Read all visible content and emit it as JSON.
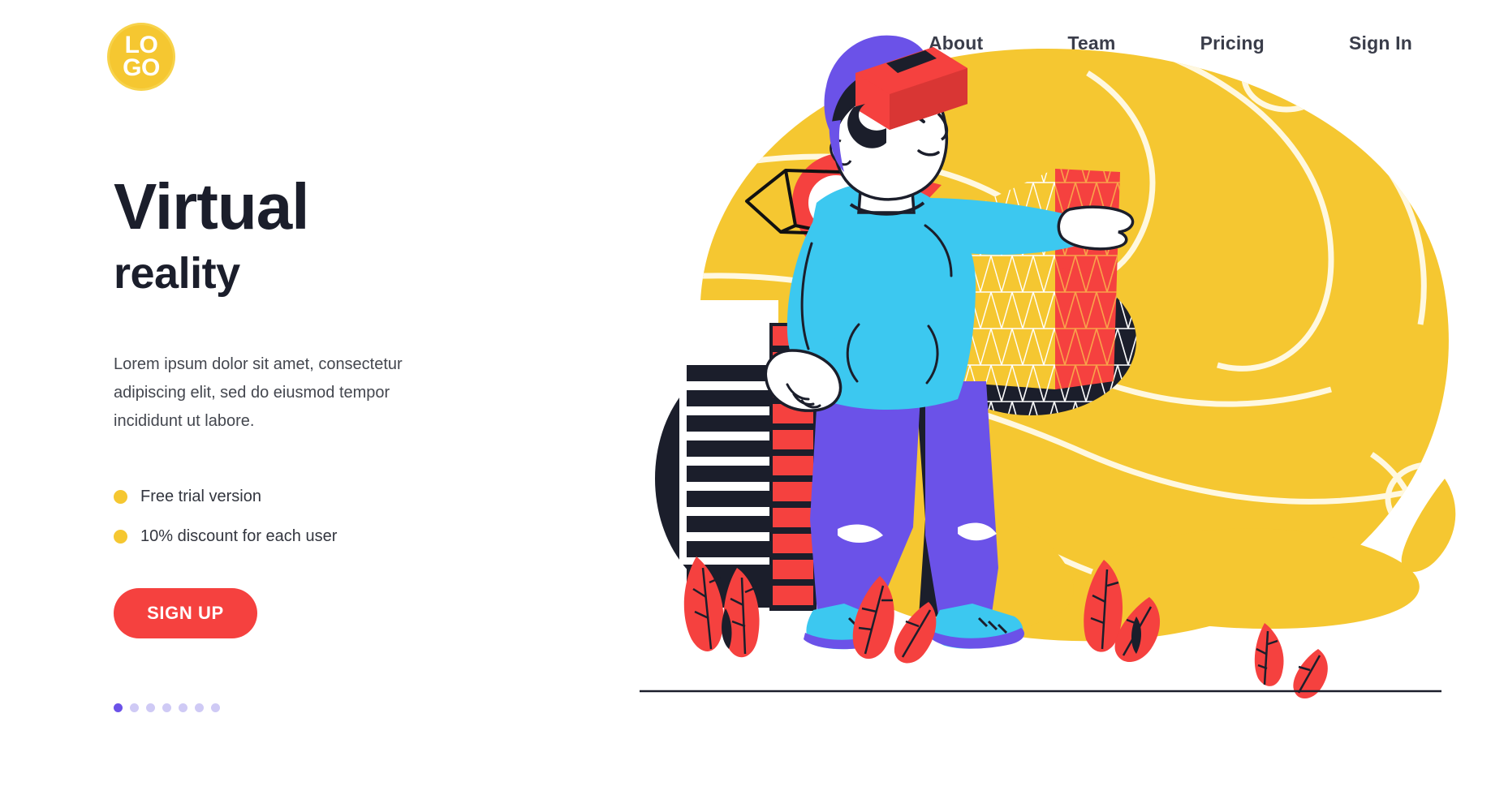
{
  "header": {
    "logo": {
      "line1": "LO",
      "line2": "GO",
      "icon": "logo-circle"
    },
    "nav": [
      {
        "label": "About"
      },
      {
        "label": "Team"
      },
      {
        "label": "Pricing"
      },
      {
        "label": "Sign In"
      }
    ]
  },
  "hero": {
    "title_line1": "Virtual",
    "title_line2": "reality",
    "paragraph": "Lorem ipsum dolor sit amet, consectetur adipiscing elit, sed do eiusmod tempor incididunt ut labore.",
    "features": [
      {
        "label": "Free trial version"
      },
      {
        "label": "10% discount for each user"
      }
    ],
    "cta_label": "SIGN UP",
    "carousel": {
      "total": 7,
      "active_index": 0
    }
  },
  "illustration": {
    "name": "vr-man-illustration",
    "description": "Man wearing a VR headset reaching toward a wireframe mesh object, standing in front of buildings on a yellow blob background"
  },
  "colors": {
    "brand_yellow": "#f5c731",
    "accent_red": "#f5413f",
    "accent_blue": "#3cc8f0",
    "accent_purple": "#6b52e8",
    "dark_navy": "#1b1e2b",
    "text_gray": "#44474f",
    "dot_inactive": "#cfcaf5",
    "white": "#ffffff"
  }
}
